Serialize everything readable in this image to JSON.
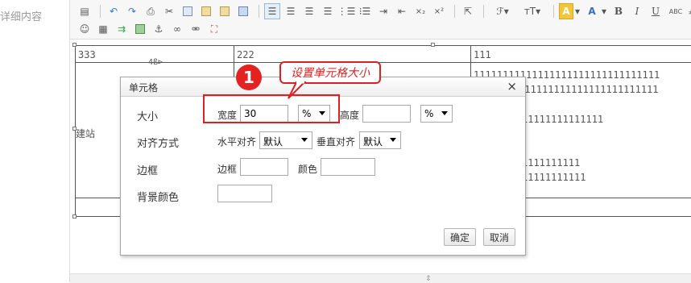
{
  "left_label": "详细内容",
  "toolbar": {
    "row1": [
      "源码",
      "撤销",
      "重做",
      "打印",
      "剪切",
      "复制",
      "粘贴",
      "粘贴为文本",
      "从Word粘贴",
      "左对齐",
      "居中",
      "右对齐",
      "两端对齐",
      "编号",
      "项目符号",
      "增加缩进",
      "减少缩进",
      "下标",
      "上标",
      "选择",
      "字体",
      "字号",
      "文字背景色",
      "文字颜色",
      "B",
      "I",
      "U",
      "ABC"
    ],
    "labels": {
      "subscript": "×₂",
      "superscript": "×²",
      "font": "ℱ",
      "fontsize": "тT",
      "bgcolor": "A",
      "color": "A",
      "bold": "B",
      "italic": "I",
      "underline": "U",
      "strike": "ABC"
    }
  },
  "table": {
    "cells": {
      "r1c1": "333",
      "r1c2": "222",
      "r1c3": "111",
      "c3_line1": "11111111111111111111111111111111",
      "c3_line2": "11111111111111111111111111111",
      "c3_line3": "11111111111111",
      "c3_line4": "1111111111",
      "c3_line5": "11111111111",
      "c1_partial": "建站",
      "c1_top_frag": "4ß⊳"
    }
  },
  "dialog": {
    "title": "单元格",
    "close": "×",
    "rows": {
      "size": "大小",
      "align": "对齐方式",
      "border": "边框",
      "bgcolor": "背景颜色"
    },
    "width_label": "宽度",
    "width_value": "30",
    "width_unit": "%",
    "height_label": "高度",
    "height_value": "",
    "height_unit": "%",
    "h_align_label": "水平对齐",
    "h_align_value": "默认",
    "v_align_label": "垂直对齐",
    "v_align_value": "默认",
    "border_label": "边框",
    "border_value": "",
    "color_label": "颜色",
    "color_value": "",
    "bg_value": "",
    "ok": "确定",
    "cancel": "取消"
  },
  "annotation": {
    "badge": "1",
    "callout": "设置单元格大小",
    "accent": "#e02020"
  }
}
